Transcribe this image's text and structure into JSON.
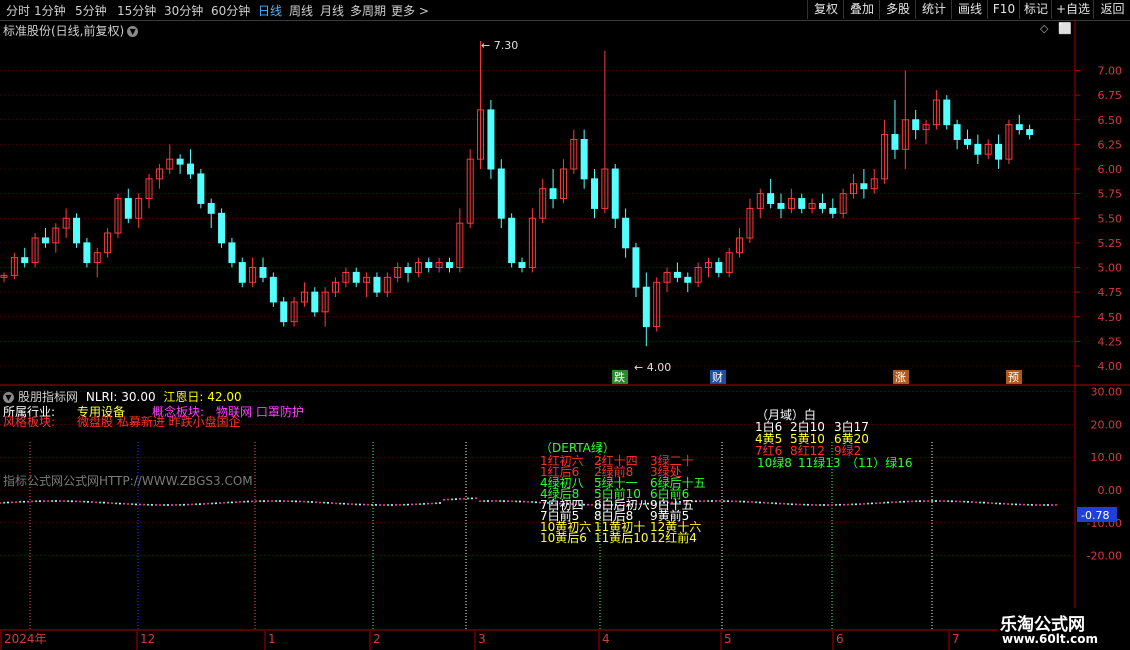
{
  "toolbar": {
    "periods": [
      "分时",
      "1分钟",
      "5分钟",
      "15分钟",
      "30分钟",
      "60分钟",
      "日线",
      "周线",
      "月线",
      "多周期",
      "更多 >"
    ],
    "active_period_index": 6,
    "buttons": [
      "复权",
      "叠加",
      "多股",
      "统计",
      "画线",
      "F10",
      "标记",
      "+自选",
      "返回"
    ]
  },
  "main_chart": {
    "title": "标准股份(日线,前复权)",
    "price_ticks": [
      "7.00",
      "6.75",
      "6.50",
      "6.25",
      "6.00",
      "5.75",
      "5.50",
      "5.25",
      "5.00",
      "4.75",
      "4.50",
      "4.25",
      "4.00"
    ],
    "high_label": "7.30",
    "low_label": "4.00",
    "event_tags": [
      "跌",
      "财",
      "涨",
      "预"
    ]
  },
  "indicator": {
    "name": "股朋指标网",
    "nlri_label": "NLRI: 30.00",
    "jiangen_label": "江恩日: 42.00",
    "industry_label": "所属行业:",
    "industry_value": "专用设备",
    "concept_label": "概念板块:",
    "concept_value": "物联网 口罩防护",
    "style_label": "风格板块:",
    "style_value": "微盘股 私募新进 昨跌小盘国企",
    "watermark": "指标公式网公式网HTTP://WWW.ZBGS3.COM",
    "ticks": [
      "30.00",
      "20.00",
      "10.00",
      "0.00",
      "-10.00",
      "-20.00"
    ],
    "current_value": "-0.78",
    "derta_title": "（DERTA绿）",
    "derta_rows": [
      [
        "1红初六",
        "2红十四",
        "3绿二十"
      ],
      [
        "1红后6",
        "2绿前8",
        "3绿处"
      ],
      [
        "4绿初八",
        "5绿十一",
        "6绿后十五"
      ],
      [
        "4绿后8",
        "5白前10",
        "6白前6"
      ],
      [
        "7白初四",
        "8白后初八",
        "9白十五"
      ],
      [
        "7白前5",
        "8白后8",
        "9黄前5"
      ],
      [
        "10黄初六",
        "11黄初十",
        "12黄十六"
      ],
      [
        "10黄后6",
        "11黄后10",
        "12红前4"
      ]
    ],
    "month_title": "（月域）白",
    "month_rows": [
      [
        "1白6",
        "2白10",
        "3白17"
      ],
      [
        "4黄5",
        "5黄10",
        "6黄20"
      ],
      [
        "7红6",
        "8红12",
        "9绿2"
      ],
      [
        "10绿8",
        "11绿13",
        "（11）绿16"
      ]
    ]
  },
  "time_axis": [
    "2024年",
    "12",
    "1",
    "2",
    "3",
    "4",
    "5",
    "6",
    "7"
  ],
  "logo": {
    "line1": "乐淘公式网",
    "line2": "www.60lt.com"
  },
  "colors": {
    "up": "#ff3a3a",
    "down": "#54ffff",
    "active": "#4fb3ff",
    "grid": "#8b0000"
  },
  "chart_data": {
    "type": "candlestick",
    "y_range": [
      3.9,
      7.4
    ],
    "candles": [
      [
        4.9,
        4.95,
        4.85,
        4.92
      ],
      [
        4.92,
        5.15,
        4.88,
        5.1
      ],
      [
        5.1,
        5.2,
        5.0,
        5.05
      ],
      [
        5.05,
        5.35,
        5.0,
        5.3
      ],
      [
        5.3,
        5.4,
        5.2,
        5.25
      ],
      [
        5.25,
        5.45,
        5.15,
        5.4
      ],
      [
        5.4,
        5.6,
        5.3,
        5.5
      ],
      [
        5.5,
        5.55,
        5.2,
        5.25
      ],
      [
        5.25,
        5.3,
        5.0,
        5.05
      ],
      [
        5.05,
        5.2,
        4.9,
        5.15
      ],
      [
        5.15,
        5.4,
        5.1,
        5.35
      ],
      [
        5.35,
        5.75,
        5.3,
        5.7
      ],
      [
        5.7,
        5.8,
        5.45,
        5.5
      ],
      [
        5.5,
        5.75,
        5.4,
        5.7
      ],
      [
        5.7,
        5.95,
        5.6,
        5.9
      ],
      [
        5.9,
        6.05,
        5.8,
        6.0
      ],
      [
        6.0,
        6.25,
        5.95,
        6.1
      ],
      [
        6.1,
        6.15,
        5.95,
        6.05
      ],
      [
        6.05,
        6.2,
        5.9,
        5.95
      ],
      [
        5.95,
        6.0,
        5.6,
        5.65
      ],
      [
        5.65,
        5.7,
        5.4,
        5.55
      ],
      [
        5.55,
        5.6,
        5.2,
        5.25
      ],
      [
        5.25,
        5.3,
        5.0,
        5.05
      ],
      [
        5.05,
        5.1,
        4.8,
        4.85
      ],
      [
        4.85,
        5.1,
        4.8,
        5.0
      ],
      [
        5.0,
        5.1,
        4.85,
        4.9
      ],
      [
        4.9,
        4.95,
        4.6,
        4.65
      ],
      [
        4.65,
        4.7,
        4.4,
        4.45
      ],
      [
        4.45,
        4.7,
        4.4,
        4.65
      ],
      [
        4.65,
        4.85,
        4.6,
        4.75
      ],
      [
        4.75,
        4.8,
        4.5,
        4.55
      ],
      [
        4.55,
        4.8,
        4.4,
        4.75
      ],
      [
        4.75,
        4.9,
        4.7,
        4.85
      ],
      [
        4.85,
        5.0,
        4.8,
        4.95
      ],
      [
        4.95,
        5.0,
        4.8,
        4.85
      ],
      [
        4.85,
        4.95,
        4.7,
        4.9
      ],
      [
        4.9,
        4.95,
        4.7,
        4.75
      ],
      [
        4.75,
        4.95,
        4.7,
        4.9
      ],
      [
        4.9,
        5.05,
        4.85,
        5.0
      ],
      [
        5.0,
        5.05,
        4.85,
        4.95
      ],
      [
        4.95,
        5.1,
        4.9,
        5.05
      ],
      [
        5.05,
        5.1,
        4.95,
        5.0
      ],
      [
        5.0,
        5.1,
        4.95,
        5.05
      ],
      [
        5.05,
        5.1,
        4.95,
        5.0
      ],
      [
        5.0,
        5.6,
        4.95,
        5.45
      ],
      [
        5.45,
        6.2,
        5.4,
        6.1
      ],
      [
        6.1,
        7.3,
        6.0,
        6.6
      ],
      [
        6.6,
        6.7,
        5.9,
        6.0
      ],
      [
        6.0,
        6.1,
        5.4,
        5.5
      ],
      [
        5.5,
        5.55,
        5.0,
        5.05
      ],
      [
        5.05,
        5.1,
        4.95,
        5.0
      ],
      [
        5.0,
        5.6,
        4.95,
        5.5
      ],
      [
        5.5,
        5.9,
        5.45,
        5.8
      ],
      [
        5.8,
        6.0,
        5.6,
        5.7
      ],
      [
        5.7,
        6.1,
        5.65,
        6.0
      ],
      [
        6.0,
        6.4,
        5.95,
        6.3
      ],
      [
        6.3,
        6.4,
        5.8,
        5.9
      ],
      [
        5.9,
        6.0,
        5.5,
        5.6
      ],
      [
        5.6,
        7.2,
        5.55,
        6.0
      ],
      [
        6.0,
        6.05,
        5.4,
        5.5
      ],
      [
        5.5,
        5.6,
        5.1,
        5.2
      ],
      [
        5.2,
        5.25,
        4.7,
        4.8
      ],
      [
        4.8,
        4.95,
        4.2,
        4.4
      ],
      [
        4.4,
        4.9,
        4.35,
        4.85
      ],
      [
        4.85,
        5.0,
        4.75,
        4.95
      ],
      [
        4.95,
        5.05,
        4.85,
        4.9
      ],
      [
        4.9,
        4.95,
        4.75,
        4.85
      ],
      [
        4.85,
        5.05,
        4.8,
        5.0
      ],
      [
        5.0,
        5.1,
        4.9,
        5.05
      ],
      [
        5.05,
        5.1,
        4.9,
        4.95
      ],
      [
        4.95,
        5.2,
        4.9,
        5.15
      ],
      [
        5.15,
        5.4,
        5.1,
        5.3
      ],
      [
        5.3,
        5.7,
        5.25,
        5.6
      ],
      [
        5.6,
        5.8,
        5.5,
        5.75
      ],
      [
        5.75,
        5.9,
        5.6,
        5.65
      ],
      [
        5.65,
        5.75,
        5.5,
        5.6
      ],
      [
        5.6,
        5.8,
        5.55,
        5.7
      ],
      [
        5.7,
        5.75,
        5.55,
        5.6
      ],
      [
        5.6,
        5.7,
        5.55,
        5.65
      ],
      [
        5.65,
        5.75,
        5.55,
        5.6
      ],
      [
        5.6,
        5.7,
        5.5,
        5.55
      ],
      [
        5.55,
        5.8,
        5.5,
        5.75
      ],
      [
        5.75,
        5.95,
        5.7,
        5.85
      ],
      [
        5.85,
        6.0,
        5.7,
        5.8
      ],
      [
        5.8,
        6.0,
        5.75,
        5.9
      ],
      [
        5.9,
        6.5,
        5.85,
        6.35
      ],
      [
        6.35,
        6.7,
        6.1,
        6.2
      ],
      [
        6.2,
        7.0,
        6.0,
        6.5
      ],
      [
        6.5,
        6.6,
        6.3,
        6.4
      ],
      [
        6.4,
        6.5,
        6.25,
        6.45
      ],
      [
        6.45,
        6.8,
        6.4,
        6.7
      ],
      [
        6.7,
        6.75,
        6.4,
        6.45
      ],
      [
        6.45,
        6.5,
        6.2,
        6.3
      ],
      [
        6.3,
        6.4,
        6.2,
        6.25
      ],
      [
        6.25,
        6.35,
        6.05,
        6.15
      ],
      [
        6.15,
        6.3,
        6.1,
        6.25
      ],
      [
        6.25,
        6.35,
        6.0,
        6.1
      ],
      [
        6.1,
        6.5,
        6.05,
        6.45
      ],
      [
        6.45,
        6.55,
        6.35,
        6.4
      ],
      [
        6.4,
        6.45,
        6.3,
        6.35
      ]
    ]
  }
}
